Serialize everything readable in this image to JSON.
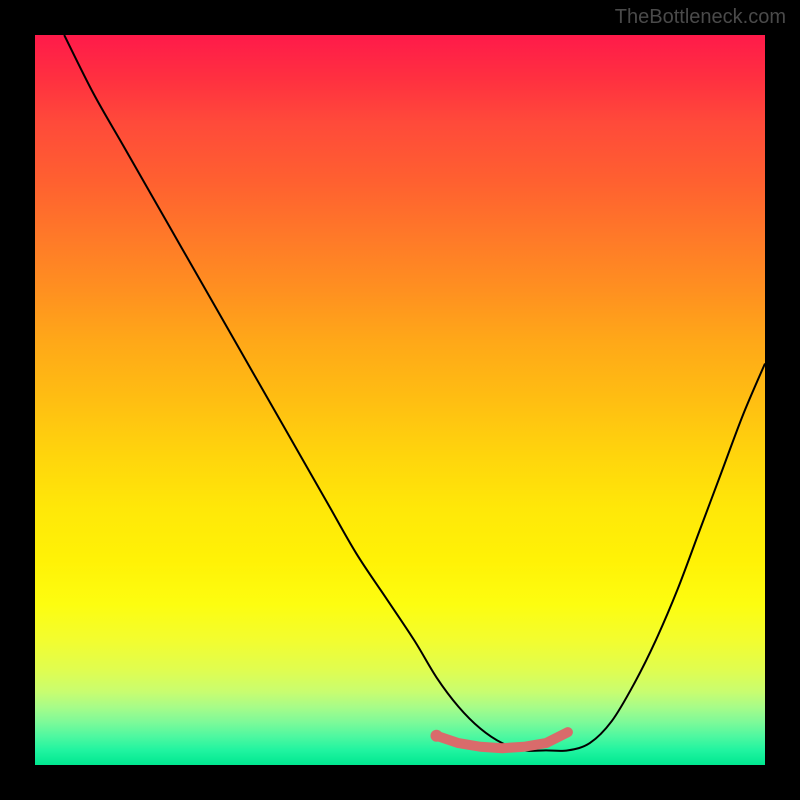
{
  "watermark": "TheBottleneck.com",
  "chart_data": {
    "type": "line",
    "title": "",
    "xlabel": "",
    "ylabel": "",
    "xlim": [
      0,
      100
    ],
    "ylim": [
      0,
      100
    ],
    "x": [
      4,
      8,
      12,
      16,
      20,
      24,
      28,
      32,
      36,
      40,
      44,
      48,
      52,
      55,
      58,
      61,
      64,
      67,
      70,
      73,
      76,
      79,
      82,
      85,
      88,
      91,
      94,
      97,
      100
    ],
    "values": [
      100,
      92,
      85,
      78,
      71,
      64,
      57,
      50,
      43,
      36,
      29,
      23,
      17,
      12,
      8,
      5,
      3,
      2,
      2,
      2,
      3,
      6,
      11,
      17,
      24,
      32,
      40,
      48,
      55
    ],
    "marker_segment": {
      "x": [
        55,
        58,
        61,
        64,
        67,
        70,
        73
      ],
      "y": [
        4,
        3,
        2.5,
        2.3,
        2.5,
        3,
        4.5
      ],
      "color": "#d96b6b"
    }
  }
}
